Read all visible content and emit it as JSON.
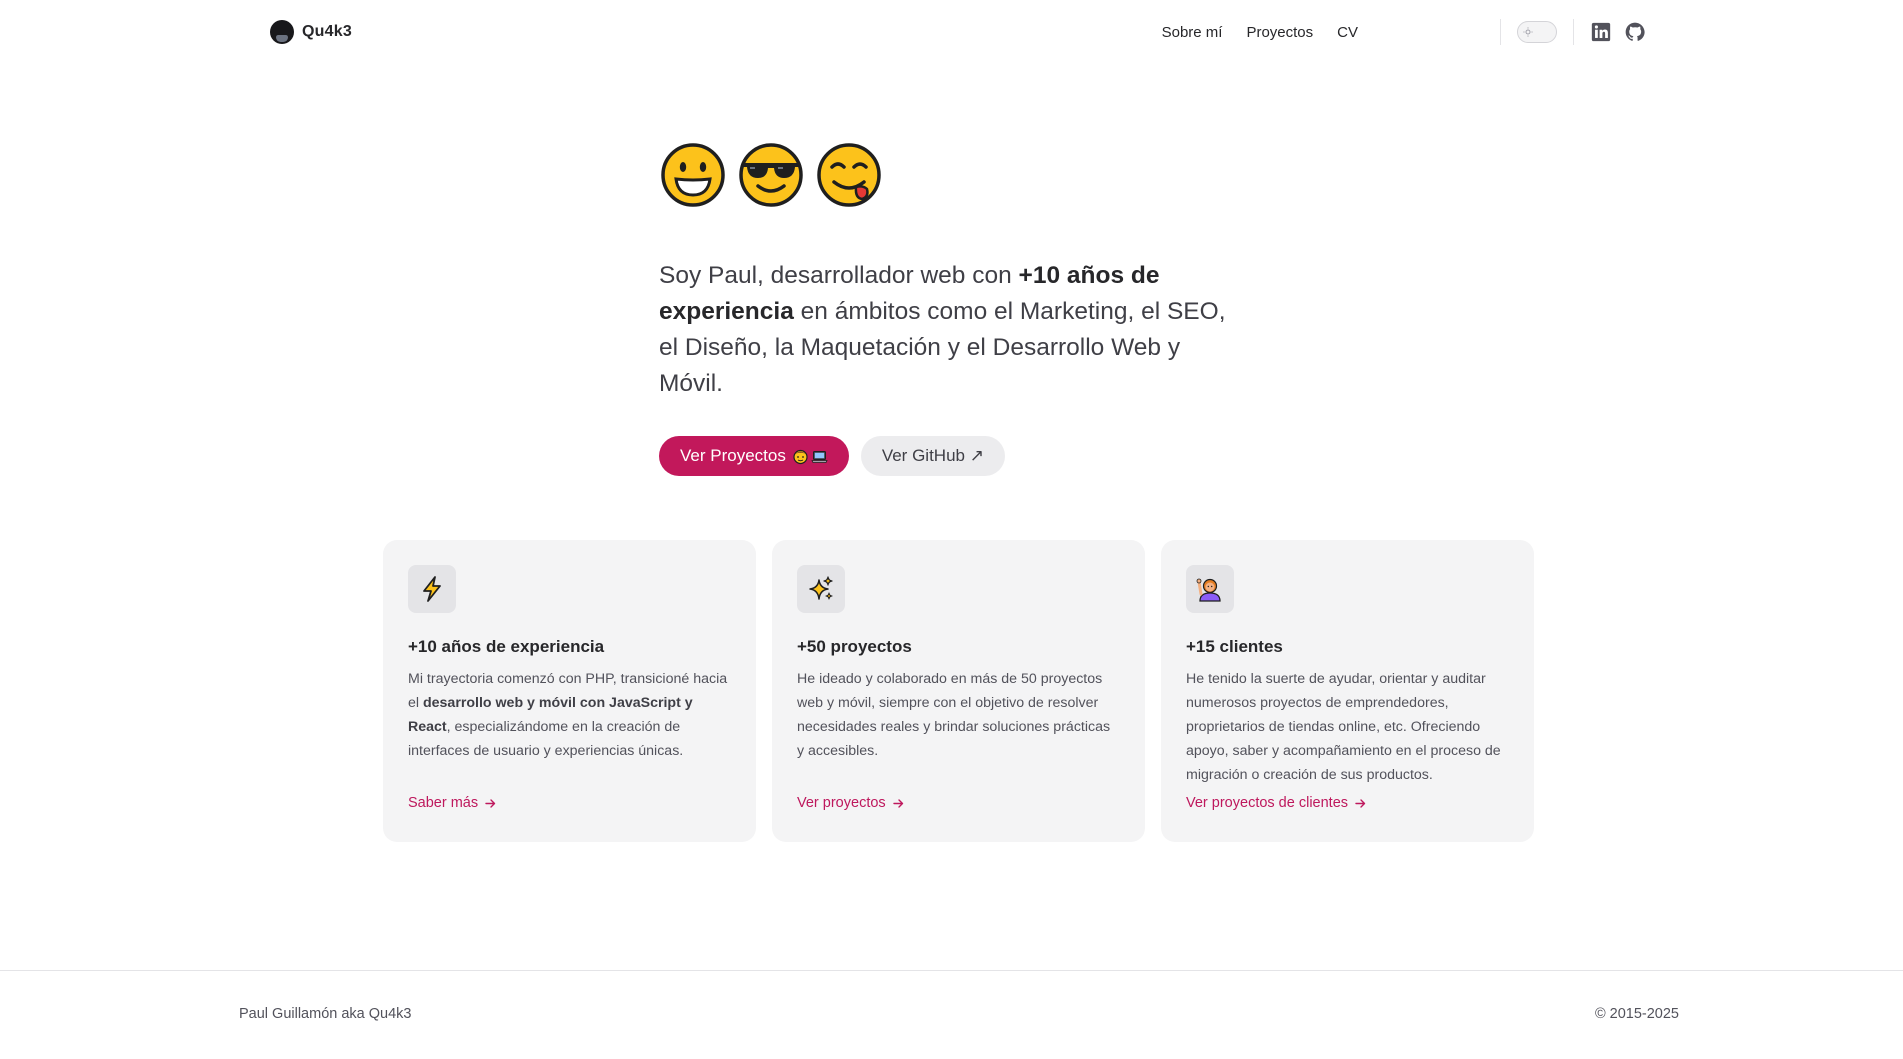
{
  "header": {
    "brand": "Qu4k3",
    "nav": [
      "Sobre mí",
      "Proyectos",
      "CV"
    ],
    "theme_toggle_icon": "sun-icon",
    "social": [
      "linkedin-icon",
      "github-icon"
    ]
  },
  "hero": {
    "emojis": [
      "grinning-face-icon",
      "sunglasses-face-icon",
      "yum-face-icon"
    ],
    "intro": {
      "part1": "Soy Paul, desarrollador web con ",
      "bold": "+10 años de experiencia",
      "part2": " en ámbitos como el Marketing, el SEO, el Diseño, la Maquetación y el Desarrollo Web y Móvil."
    },
    "buttons": {
      "primary_label": "Ver Proyectos",
      "primary_emojis": [
        "technologist-icon",
        "laptop-icon"
      ],
      "secondary_label": "Ver GitHub ↗"
    }
  },
  "cards": [
    {
      "icon": "high-voltage-icon",
      "title": "+10 años de experiencia",
      "text_1": "Mi trayectoria comenzó con PHP, transicioné hacia el ",
      "text_bold": "desarrollo web y móvil con JavaScript y React",
      "text_2": ", especializándome en la creación de interfaces de usuario y experiencias únicas.",
      "link": "Saber más"
    },
    {
      "icon": "sparkles-icon",
      "title": "+50 proyectos",
      "text_1": "He ideado y colaborado en más de 50 proyectos web y móvil, siempre con el objetivo de resolver necesidades reales y brindar soluciones prácticas y accesibles.",
      "text_bold": "",
      "text_2": "",
      "link": "Ver proyectos"
    },
    {
      "icon": "person-raising-hand-icon",
      "title": "+15 clientes",
      "text_1": "He tenido la suerte de ayudar, orientar y auditar numerosos proyectos de emprendedores, proprietarios de tiendas online, etc. Ofreciendo apoyo, saber y acompañamiento en el proceso de migración o creación de sus productos.",
      "text_bold": "",
      "text_2": "",
      "link": "Ver proyectos de clientes"
    }
  ],
  "footer": {
    "left": "Paul Guillamón aka Qu4k3",
    "right": "© 2015-2025"
  },
  "colors": {
    "accent": "#c2185b",
    "link": "#be185d",
    "card_bg": "#f4f4f5",
    "text": "#27272a"
  }
}
